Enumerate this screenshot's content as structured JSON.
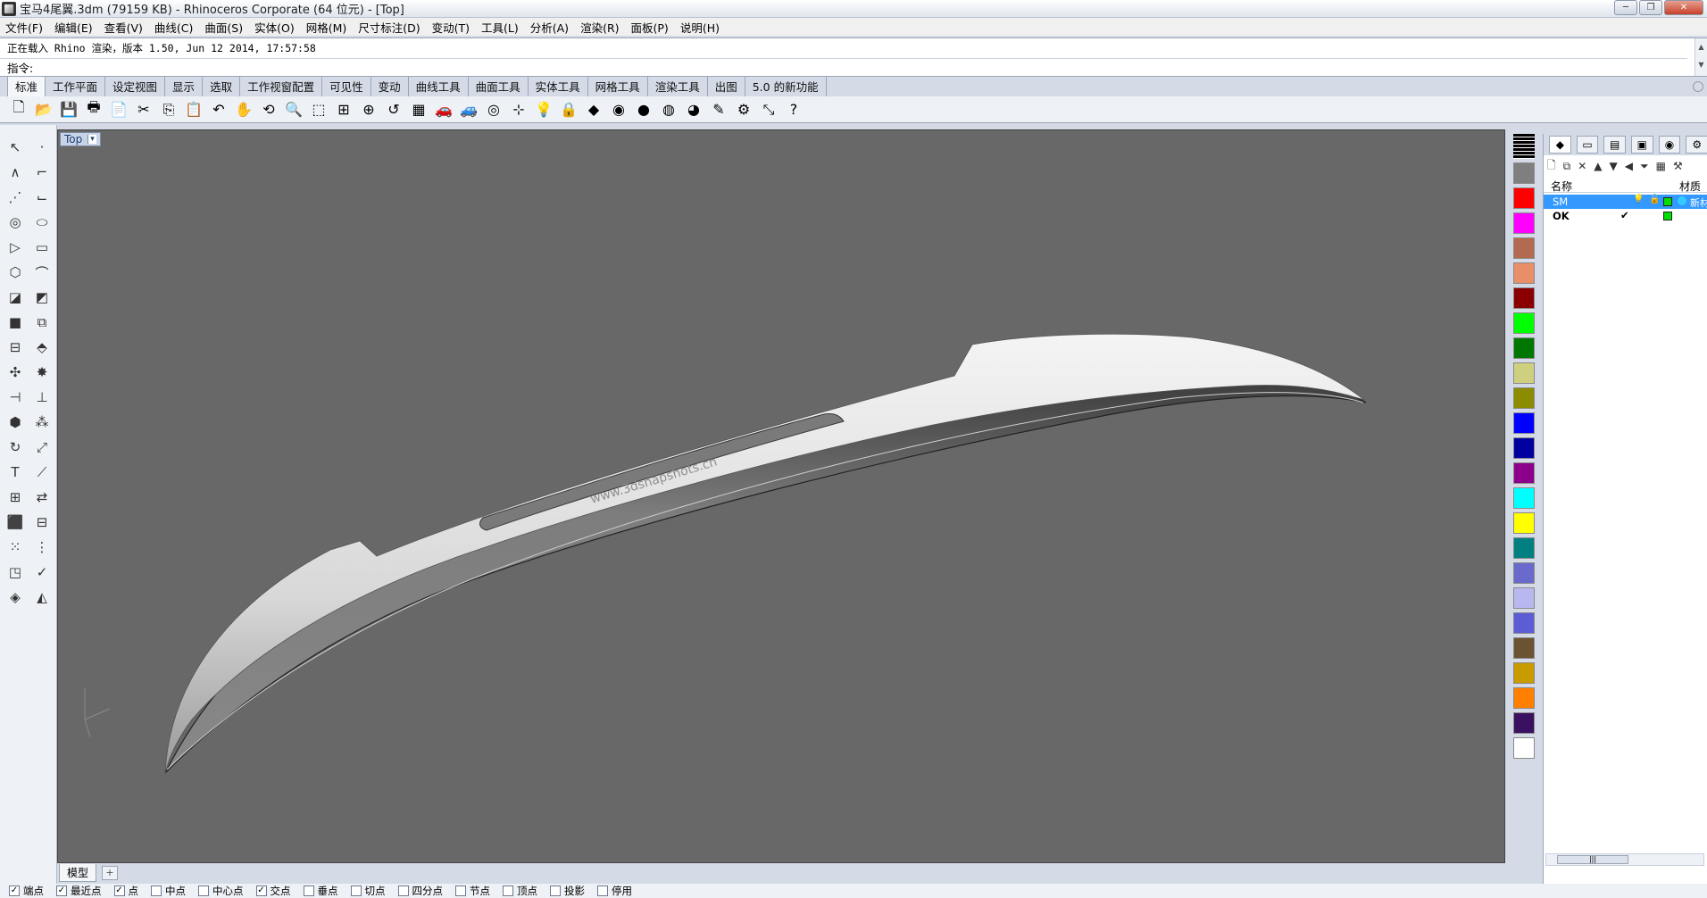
{
  "window": {
    "title": "宝马4尾翼.3dm (79159 KB) - Rhinoceros Corporate (64 位元) - [Top]"
  },
  "menu": [
    "文件(F)",
    "编辑(E)",
    "查看(V)",
    "曲线(C)",
    "曲面(S)",
    "实体(O)",
    "网格(M)",
    "尺寸标注(D)",
    "变动(T)",
    "工具(L)",
    "分析(A)",
    "渲染(R)",
    "面板(P)",
    "说明(H)"
  ],
  "command": {
    "history_line": "正在载入 Rhino 渲染，版本 1.50, Jun 12 2014, 17:57:58",
    "prompt_label": "指令:",
    "input_value": ""
  },
  "tabs": [
    "标准",
    "工作平面",
    "设定视图",
    "显示",
    "选取",
    "工作视窗配置",
    "可见性",
    "变动",
    "曲线工具",
    "曲面工具",
    "实体工具",
    "网格工具",
    "渲染工具",
    "出图",
    "5.0 的新功能"
  ],
  "toolbar_icons": [
    "new-file-icon",
    "open-file-icon",
    "save-icon",
    "print-icon",
    "import-icon",
    "cut-icon",
    "copy-icon",
    "paste-icon",
    "undo-icon",
    "pan-icon",
    "rotate-view-icon",
    "zoom-icon",
    "zoom-window-icon",
    "zoom-extents-icon",
    "zoom-selected-icon",
    "undo-view-icon",
    "four-viewports-icon",
    "car-icon",
    "render-car-icon",
    "osnap-icon",
    "select-points-icon",
    "light-bulb-icon",
    "lock-icon",
    "layer-icon",
    "color-wheel-icon",
    "render-sphere-icon",
    "material-sphere-icon",
    "environment-sphere-icon",
    "pen-icon",
    "gear-options-icon",
    "dimension-icon",
    "help-icon"
  ],
  "toolbar_glyphs": [
    "🗋",
    "📂",
    "💾",
    "🖶",
    "📄",
    "✂",
    "⎘",
    "📋",
    "↶",
    "✋",
    "⟲",
    "🔍",
    "⬚",
    "⊞",
    "⊕",
    "↺",
    "▦",
    "🚗",
    "🚙",
    "◎",
    "⊹",
    "💡",
    "🔒",
    "◆",
    "◉",
    "●",
    "◍",
    "◕",
    "✎",
    "⚙",
    "⤡",
    "?"
  ],
  "left_tools": [
    {
      "name": "select-arrow-icon",
      "glyph": "↖"
    },
    {
      "name": "point-icon",
      "glyph": "·"
    },
    {
      "name": "polyline-icon",
      "glyph": "∧"
    },
    {
      "name": "curve-points-icon",
      "glyph": "⌐"
    },
    {
      "name": "curve-tools-icon",
      "glyph": "⋰"
    },
    {
      "name": "control-curve-icon",
      "glyph": "⌙"
    },
    {
      "name": "circle-icon",
      "glyph": "◎"
    },
    {
      "name": "ellipse-icon",
      "glyph": "⬭"
    },
    {
      "name": "polygon-icon",
      "glyph": "▷"
    },
    {
      "name": "rectangle-icon",
      "glyph": "▭"
    },
    {
      "name": "text-object-icon",
      "glyph": "⬡"
    },
    {
      "name": "fillet-curve-icon",
      "glyph": "⌒"
    },
    {
      "name": "surface-edit-icon",
      "glyph": "◪"
    },
    {
      "name": "surface-tools-icon",
      "glyph": "◩"
    },
    {
      "name": "box-solid-icon",
      "glyph": "■"
    },
    {
      "name": "boolean-icon",
      "glyph": "⧉"
    },
    {
      "name": "cylinder-icon",
      "glyph": "⊟"
    },
    {
      "name": "extrude-icon",
      "glyph": "⬘"
    },
    {
      "name": "transform-icon",
      "glyph": "✣"
    },
    {
      "name": "explode-icon",
      "glyph": "✸"
    },
    {
      "name": "trim-icon",
      "glyph": "⊣"
    },
    {
      "name": "split-icon",
      "glyph": "⊥"
    },
    {
      "name": "group-icon",
      "glyph": "⬢"
    },
    {
      "name": "join-icon",
      "glyph": "⁂"
    },
    {
      "name": "rotate-icon",
      "glyph": "↻"
    },
    {
      "name": "scale-icon",
      "glyph": "⤢"
    },
    {
      "name": "text-icon",
      "glyph": "T"
    },
    {
      "name": "dimension-tool-icon",
      "glyph": "⟋"
    },
    {
      "name": "array-icon",
      "glyph": "⊞"
    },
    {
      "name": "mirror-icon",
      "glyph": "⇄"
    },
    {
      "name": "solid-tools-icon",
      "glyph": "⬛"
    },
    {
      "name": "mesh-icon",
      "glyph": "⊟"
    },
    {
      "name": "grid-icon",
      "glyph": "⁙"
    },
    {
      "name": "points-on-icon",
      "glyph": "⋮"
    },
    {
      "name": "analyze-icon",
      "glyph": "◳"
    },
    {
      "name": "check-icon",
      "glyph": "✓"
    },
    {
      "name": "render-icon",
      "glyph": "◈"
    },
    {
      "name": "paint-icon",
      "glyph": "◭"
    }
  ],
  "viewport": {
    "title": "Top",
    "dropdown_arrow": "▾",
    "background": "#686868",
    "watermark": "www.3dsnapshots.cn"
  },
  "viewport_tabs": {
    "active": "模型",
    "add": "+"
  },
  "osnaps": [
    {
      "label": "端点",
      "checked": true
    },
    {
      "label": "最近点",
      "checked": true
    },
    {
      "label": "点",
      "checked": true
    },
    {
      "label": "中点",
      "checked": false
    },
    {
      "label": "中心点",
      "checked": false
    },
    {
      "label": "交点",
      "checked": true
    },
    {
      "label": "垂点",
      "checked": false
    },
    {
      "label": "切点",
      "checked": false
    },
    {
      "label": "四分点",
      "checked": false
    },
    {
      "label": "节点",
      "checked": false
    },
    {
      "label": "顶点",
      "checked": false
    },
    {
      "label": "投影",
      "checked": false
    },
    {
      "label": "停用",
      "checked": false
    }
  ],
  "swatches": [
    "#7f7f7f",
    "#ff0000",
    "#ff00ff",
    "#b26b50",
    "#e88e68",
    "#8a0000",
    "#00ff00",
    "#007700",
    "#cfcf80",
    "#8c8c00",
    "#0000ff",
    "#0000a0",
    "#8c008c",
    "#00ffff",
    "#ffff00",
    "#008080",
    "#6a6acd",
    "#b8b8f0",
    "#5c5cd6",
    "#6b5232",
    "#c89b00",
    "#ff7f00",
    "#3a1060",
    "#ffffff"
  ],
  "right_panel": {
    "tab_icons": [
      "layers-tab-icon",
      "display-tab-icon",
      "properties-tab-icon",
      "render-tab-icon",
      "materials-tab-icon",
      "settings-tab-icon"
    ],
    "tool_glyphs": [
      "🗋",
      "⧉",
      "✕",
      "▲",
      "▼",
      "◀",
      "⏷",
      "▦",
      "⚒"
    ],
    "header_name": "名称",
    "header_material": "材质",
    "layers": [
      {
        "name": "SM",
        "selected": true,
        "color": "#00e000",
        "material_color": "#33ccff",
        "material_name": "新材",
        "lock": "🔓",
        "bulb": "💡"
      },
      {
        "name": "OK",
        "selected": false,
        "color": "#00e000",
        "check": "✔"
      }
    ],
    "hscroll_thumb": "|||"
  }
}
